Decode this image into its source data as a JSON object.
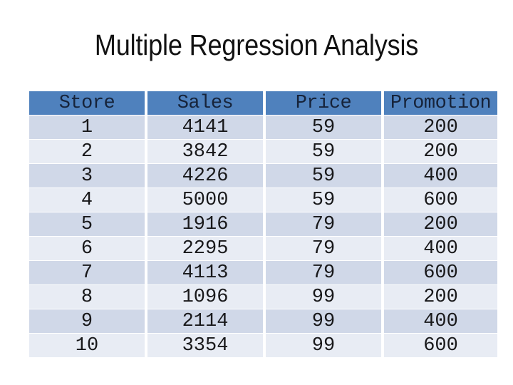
{
  "slide": {
    "title": "Multiple Regression Analysis",
    "background_color": "#ffffff",
    "title_color": "#121212"
  },
  "table": {
    "header_bg": "#4f81bd",
    "header_text_color": "#16233a",
    "row_band_dark": "#d0d8e8",
    "row_band_light": "#e8ecf4",
    "columns": [
      "Store",
      "Sales",
      "Price",
      "Promotion"
    ],
    "rows": [
      [
        "1",
        "4141",
        "59",
        "200"
      ],
      [
        "2",
        "3842",
        "59",
        "200"
      ],
      [
        "3",
        "4226",
        "59",
        "400"
      ],
      [
        "4",
        "5000",
        "59",
        "600"
      ],
      [
        "5",
        "1916",
        "79",
        "200"
      ],
      [
        "6",
        "2295",
        "79",
        "400"
      ],
      [
        "7",
        "4113",
        "79",
        "600"
      ],
      [
        "8",
        "1096",
        "99",
        "200"
      ],
      [
        "9",
        "2114",
        "99",
        "400"
      ],
      [
        "10",
        "3354",
        "99",
        "600"
      ]
    ]
  },
  "chart_data": {
    "type": "table",
    "title": "Multiple Regression Analysis",
    "columns": [
      "Store",
      "Sales",
      "Price",
      "Promotion"
    ],
    "records": [
      {
        "Store": 1,
        "Sales": 4141,
        "Price": 59,
        "Promotion": 200
      },
      {
        "Store": 2,
        "Sales": 3842,
        "Price": 59,
        "Promotion": 200
      },
      {
        "Store": 3,
        "Sales": 4226,
        "Price": 59,
        "Promotion": 400
      },
      {
        "Store": 4,
        "Sales": 5000,
        "Price": 59,
        "Promotion": 600
      },
      {
        "Store": 5,
        "Sales": 1916,
        "Price": 79,
        "Promotion": 200
      },
      {
        "Store": 6,
        "Sales": 2295,
        "Price": 79,
        "Promotion": 400
      },
      {
        "Store": 7,
        "Sales": 4113,
        "Price": 79,
        "Promotion": 600
      },
      {
        "Store": 8,
        "Sales": 1096,
        "Price": 99,
        "Promotion": 200
      },
      {
        "Store": 9,
        "Sales": 2114,
        "Price": 99,
        "Promotion": 400
      },
      {
        "Store": 10,
        "Sales": 3354,
        "Price": 99,
        "Promotion": 600
      }
    ]
  }
}
